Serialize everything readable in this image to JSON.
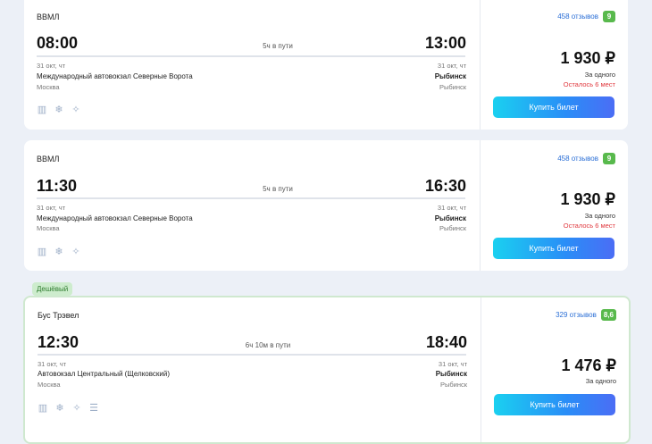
{
  "trips": [
    {
      "carrier": "ВВМЛ",
      "dep_time": "08:00",
      "arr_time": "13:00",
      "duration": "5ч в пути",
      "dep_date": "31 окт, чт",
      "arr_date": "31 окт, чт",
      "dep_station": "Международный автовокзал Северные Ворота",
      "arr_station": "Рыбинск",
      "dep_city": "Москва",
      "arr_city": "Рыбинск",
      "reviews": "458 отзывов",
      "rating": "9",
      "price": "1 930 ₽",
      "per": "За одного",
      "seats_left": "Осталось 6 мест",
      "buy_label": "Купить билет"
    },
    {
      "carrier": "ВВМЛ",
      "dep_time": "11:30",
      "arr_time": "16:30",
      "duration": "5ч в пути",
      "dep_date": "31 окт, чт",
      "arr_date": "31 окт, чт",
      "dep_station": "Международный автовокзал Северные Ворота",
      "arr_station": "Рыбинск",
      "dep_city": "Москва",
      "arr_city": "Рыбинск",
      "reviews": "458 отзывов",
      "rating": "9",
      "price": "1 930 ₽",
      "per": "За одного",
      "seats_left": "Осталось 6 мест",
      "buy_label": "Купить билет"
    },
    {
      "badge": "Дешёвый",
      "carrier": "Бус Трэвел",
      "dep_time": "12:30",
      "arr_time": "18:40",
      "duration": "6ч 10м в пути",
      "dep_date": "31 окт, чт",
      "arr_date": "31 окт, чт",
      "dep_station": "Автовокзал Центральный (Щелковский)",
      "arr_station": "Рыбинск",
      "dep_city": "Москва",
      "arr_city": "Рыбинск",
      "reviews": "329 отзывов",
      "rating": "8,6",
      "price": "1 476 ₽",
      "per": "За одного",
      "buy_label": "Купить билет"
    }
  ],
  "icons": [
    "ticket-icon",
    "air-conditioning-icon",
    "cleaning-icon",
    "wifi-icon"
  ],
  "colors": {
    "accent": "#2a8df7",
    "rating": "#58b94c",
    "warning": "#e0383e",
    "cheap_bg": "#cdeccd"
  }
}
